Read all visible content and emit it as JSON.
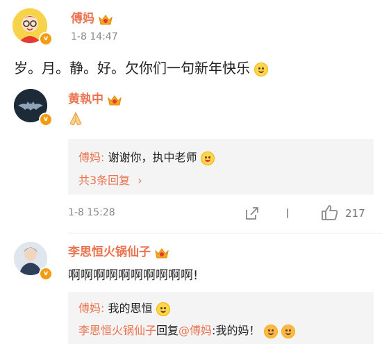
{
  "post": {
    "author": "傅妈",
    "time": "1-8 14:47",
    "text": "岁。月。静。好。欠你们一句新年快乐"
  },
  "comment1": {
    "author": "黄執中",
    "reply_author": "傅妈:",
    "reply_text": " 谢谢你，执中老师",
    "more_replies": "共3条回复",
    "time": "1-8 15:28",
    "like_count": "217"
  },
  "comment2": {
    "author": "李思恒火锅仙子",
    "text": "啊啊啊啊啊啊啊啊啊啊!",
    "reply1_author": "傅妈:",
    "reply1_text": " 我的思恒",
    "reply2_author": "李思恒火锅仙子",
    "reply2_mid": "回复",
    "reply2_target": "@傅妈",
    "reply2_text": ":我的妈！"
  },
  "colors": {
    "brand_orange": "#eb7350",
    "vip_badge": "#f39c12",
    "quote_bg": "#f4f4f4"
  },
  "icons": [
    "verified-badge-icon",
    "crown-vip-icon",
    "praying-hands-icon",
    "share-icon",
    "more-icon",
    "thumbs-up-icon",
    "smile-emoji-icon",
    "chevron-right-icon"
  ]
}
